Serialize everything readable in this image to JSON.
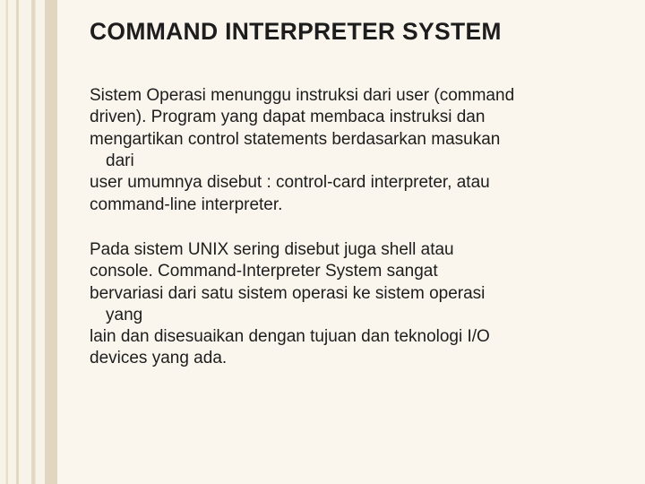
{
  "title": "COMMAND INTERPRETER SYSTEM",
  "p1": {
    "l1": "Sistem Operasi menunggu instruksi dari user (command",
    "l2": "driven). Program yang dapat membaca instruksi dan",
    "l3": "mengartikan control statements berdasarkan masukan",
    "l4": "dari",
    "l5": "user umumnya disebut : control-card interpreter, atau",
    "l6": "command-line interpreter."
  },
  "p2": {
    "l1": "Pada sistem UNIX sering disebut juga shell atau",
    "l2": "console. Command-Interpreter System sangat",
    "l3": "bervariasi dari satu sistem operasi ke sistem operasi",
    "l4": "yang",
    "l5": "lain dan disesuaikan dengan tujuan dan teknologi I/O",
    "l6": "devices yang ada."
  }
}
